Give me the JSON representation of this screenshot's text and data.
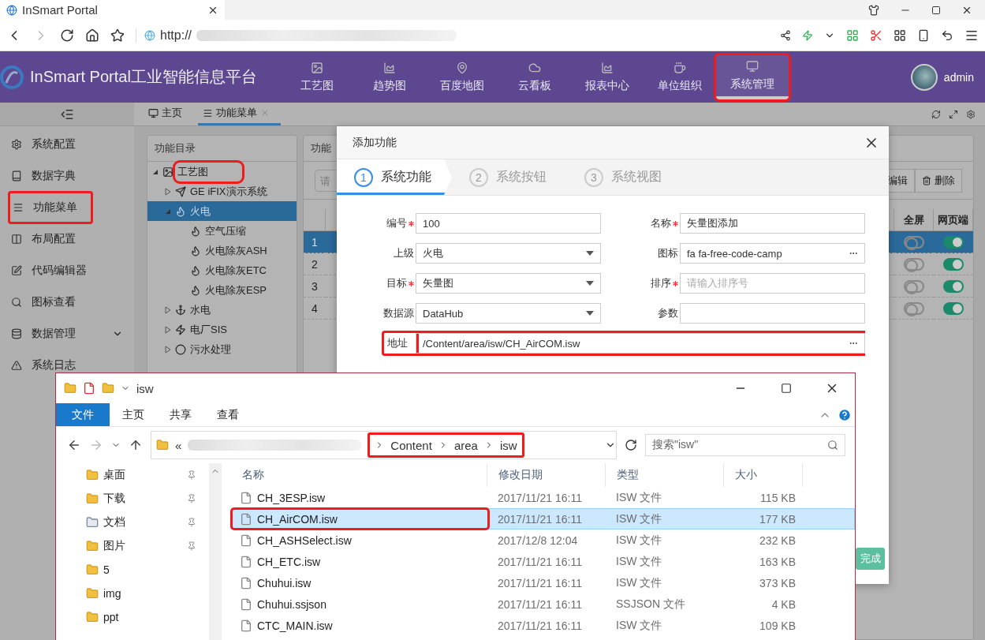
{
  "browser": {
    "tab_title": "InSmart Portal",
    "address": "http://"
  },
  "header": {
    "brand": "InSmart Portal工业智能信息平台",
    "user": "admin",
    "nav": [
      {
        "label": "工艺图",
        "selected": false,
        "highlighted": false
      },
      {
        "label": "趋势图",
        "selected": false,
        "highlighted": false
      },
      {
        "label": "百度地图",
        "selected": false,
        "highlighted": false
      },
      {
        "label": "云看板",
        "selected": false,
        "highlighted": false
      },
      {
        "label": "报表中心",
        "selected": false,
        "highlighted": false
      },
      {
        "label": "单位组织",
        "selected": false,
        "highlighted": false
      },
      {
        "label": "系统管理",
        "selected": true,
        "highlighted": true
      }
    ]
  },
  "sidebar": {
    "items": [
      {
        "label": "系统配置",
        "highlighted": false,
        "expandable": false
      },
      {
        "label": "数据字典",
        "highlighted": false,
        "expandable": false
      },
      {
        "label": "功能菜单",
        "highlighted": true,
        "expandable": false
      },
      {
        "label": "布局配置",
        "highlighted": false,
        "expandable": false
      },
      {
        "label": "代码编辑器",
        "highlighted": false,
        "expandable": false
      },
      {
        "label": "图标查看",
        "highlighted": false,
        "expandable": false
      },
      {
        "label": "数据管理",
        "highlighted": false,
        "expandable": true
      },
      {
        "label": "系统日志",
        "highlighted": false,
        "expandable": false
      }
    ]
  },
  "tabs": [
    {
      "label": "主页",
      "selected": false,
      "closable": false
    },
    {
      "label": "功能菜单",
      "selected": true,
      "closable": true
    }
  ],
  "tree": {
    "title": "功能目录",
    "items": [
      {
        "label": "工艺图",
        "expanded": true,
        "selected": false,
        "highlighted": true,
        "children": [
          {
            "label": "GE iFIX演示系统",
            "expanded": false,
            "selected": false,
            "highlighted": false
          },
          {
            "label": "火电",
            "expanded": true,
            "selected": true,
            "highlighted": false,
            "children": [
              {
                "label": "空气压缩",
                "selected": false,
                "highlighted": false
              },
              {
                "label": "火电除灰ASH",
                "selected": false,
                "highlighted": false
              },
              {
                "label": "火电除灰ETC",
                "selected": false,
                "highlighted": false
              },
              {
                "label": "火电除灰ESP",
                "selected": false,
                "highlighted": false
              }
            ]
          },
          {
            "label": "水电",
            "expanded": false,
            "selected": false,
            "highlighted": false
          },
          {
            "label": "电厂SIS",
            "expanded": false,
            "selected": false,
            "highlighted": false
          },
          {
            "label": "污水处理",
            "expanded": false,
            "selected": false,
            "highlighted": false
          }
        ]
      }
    ]
  },
  "table_panel": {
    "title": "功能",
    "search_placeholder": "请",
    "buttons": [
      "编辑",
      "删除"
    ],
    "columns": [
      "全屏",
      "网页端"
    ],
    "rows": [
      {
        "index": "1",
        "fullscreen": false,
        "web": true,
        "selected": true
      },
      {
        "index": "2",
        "fullscreen": false,
        "web": true,
        "selected": false
      },
      {
        "index": "3",
        "fullscreen": false,
        "web": true,
        "selected": false
      },
      {
        "index": "4",
        "fullscreen": false,
        "web": true,
        "selected": false
      }
    ]
  },
  "dialog": {
    "title": "添加功能",
    "steps": [
      {
        "number": "1",
        "label": "系统功能",
        "selected": true
      },
      {
        "number": "2",
        "label": "系统按钮",
        "selected": false
      },
      {
        "number": "3",
        "label": "系统视图",
        "selected": false
      }
    ],
    "fields": [
      {
        "label": "编号",
        "kind": "text",
        "required": true,
        "value": "100",
        "highlighted": false,
        "wide": false
      },
      {
        "label": "名称",
        "kind": "text",
        "required": true,
        "value": "矢量图添加",
        "highlighted": false,
        "wide": false
      },
      {
        "label": "上级",
        "kind": "select",
        "required": false,
        "value": "火电",
        "highlighted": false,
        "wide": false
      },
      {
        "label": "图标",
        "kind": "picker",
        "required": false,
        "value": "fa fa-free-code-camp",
        "highlighted": false,
        "wide": false
      },
      {
        "label": "目标",
        "kind": "select",
        "required": true,
        "value": "矢量图",
        "highlighted": false,
        "wide": false
      },
      {
        "label": "排序",
        "kind": "text",
        "required": true,
        "placeholder": "请输入排序号",
        "highlighted": false,
        "wide": false
      },
      {
        "label": "数据源",
        "kind": "select",
        "required": false,
        "value": "DataHub",
        "highlighted": false,
        "wide": false
      },
      {
        "label": "参数",
        "kind": "text",
        "required": false,
        "highlighted": false,
        "wide": false
      },
      {
        "label": "地址",
        "kind": "picker",
        "required": false,
        "value": "/Content/area/isw/CH_AirCOM.isw",
        "highlighted": true,
        "wide": true
      }
    ],
    "finish_button": "完成"
  },
  "explorer": {
    "title": "isw",
    "ribbon_tabs": [
      {
        "label": "文件",
        "selected": true
      },
      {
        "label": "主页",
        "selected": false
      },
      {
        "label": "共享",
        "selected": false
      },
      {
        "label": "查看",
        "selected": false
      }
    ],
    "path_prefix": "«",
    "path": {
      "segments": [
        "Content",
        "area",
        "isw"
      ],
      "highlighted": true
    },
    "search_placeholder": "搜索\"isw\"",
    "nav": [
      {
        "label": "桌面",
        "pinned": true
      },
      {
        "label": "下载",
        "pinned": true
      },
      {
        "label": "文档",
        "pinned": true
      },
      {
        "label": "图片",
        "pinned": true
      },
      {
        "label": "5",
        "pinned": false
      },
      {
        "label": "img",
        "pinned": false
      },
      {
        "label": "ppt",
        "pinned": false
      }
    ],
    "columns": [
      "名称",
      "修改日期",
      "类型",
      "大小"
    ],
    "files": [
      {
        "name": "CH_3ESP.isw",
        "date": "2017/11/21 16:11",
        "type": "ISW 文件",
        "size": "115 KB",
        "selected": false,
        "highlighted": false
      },
      {
        "name": "CH_AirCOM.isw",
        "date": "2017/11/21 16:11",
        "type": "ISW 文件",
        "size": "177 KB",
        "selected": true,
        "highlighted": true
      },
      {
        "name": "CH_ASHSelect.isw",
        "date": "2017/12/8 12:04",
        "type": "ISW 文件",
        "size": "232 KB",
        "selected": false,
        "highlighted": false
      },
      {
        "name": "CH_ETC.isw",
        "date": "2017/11/21 16:11",
        "type": "ISW 文件",
        "size": "163 KB",
        "selected": false,
        "highlighted": false
      },
      {
        "name": "Chuhui.isw",
        "date": "2017/11/21 16:11",
        "type": "ISW 文件",
        "size": "373 KB",
        "selected": false,
        "highlighted": false
      },
      {
        "name": "Chuhui.ssjson",
        "date": "2017/11/21 16:11",
        "type": "SSJSON 文件",
        "size": "4 KB",
        "selected": false,
        "highlighted": false
      },
      {
        "name": "CTC_MAIN.isw",
        "date": "2017/11/21 16:11",
        "type": "ISW 文件",
        "size": "109 KB",
        "selected": false,
        "highlighted": false
      }
    ]
  }
}
